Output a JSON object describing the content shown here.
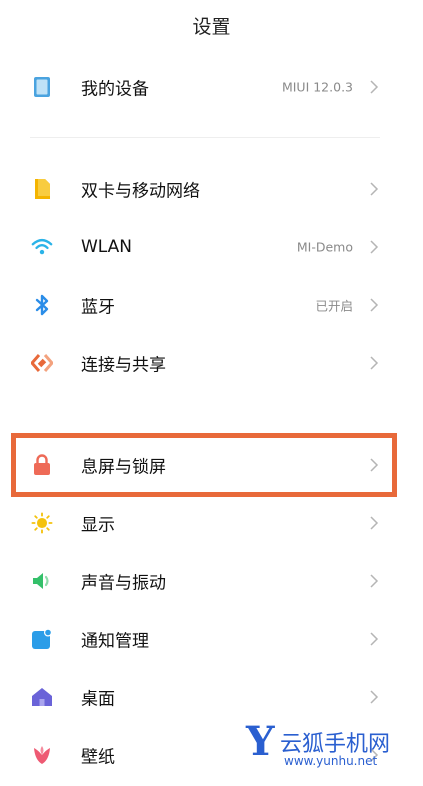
{
  "header": {
    "title": "设置"
  },
  "rows": [
    {
      "label": "我的设备",
      "value": "MIUI 12.0.3",
      "icon": "tablet-icon",
      "color": "#4aa3df"
    },
    {
      "label": "双卡与移动网络",
      "value": "",
      "icon": "sim-card-icon",
      "color": "#f4b400"
    },
    {
      "label": "WLAN",
      "value": "MI-Demo",
      "icon": "wifi-icon",
      "color": "#2bb3e8"
    },
    {
      "label": "蓝牙",
      "value": "已开启",
      "icon": "bluetooth-icon",
      "color": "#2b8de8"
    },
    {
      "label": "连接与共享",
      "value": "",
      "icon": "share-icon",
      "color": "#e8693a"
    },
    {
      "label": "息屏与锁屏",
      "value": "",
      "icon": "lock-icon",
      "color": "#ee6a57"
    },
    {
      "label": "显示",
      "value": "",
      "icon": "sun-icon",
      "color": "#f4c20d"
    },
    {
      "label": "声音与振动",
      "value": "",
      "icon": "speaker-icon",
      "color": "#34c06a"
    },
    {
      "label": "通知管理",
      "value": "",
      "icon": "notification-icon",
      "color": "#2b9de8"
    },
    {
      "label": "桌面",
      "value": "",
      "icon": "home-icon",
      "color": "#6a63d8"
    },
    {
      "label": "壁纸",
      "value": "",
      "icon": "flower-icon",
      "color": "#ee5a73"
    }
  ],
  "highlight_color": "#e8693a",
  "watermark": {
    "letter": "Y",
    "name": "云狐手机网",
    "url": "www.yunhu.net",
    "color": "#2a5fd0"
  }
}
